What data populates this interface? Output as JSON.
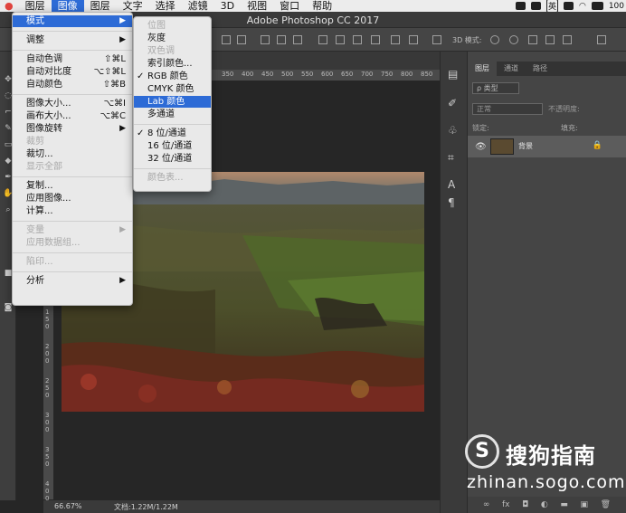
{
  "menubar": {
    "items": [
      "图像",
      "文字",
      "选择",
      "滤镜",
      "3D",
      "视图",
      "窗口",
      "帮助"
    ],
    "active_item": "图像",
    "prev_item": "图层",
    "right": {
      "input_method": "英",
      "extra": "100"
    }
  },
  "window": {
    "title": "Adobe Photoshop CC 2017"
  },
  "optionbar": {
    "mode_3d": "3D 模式:"
  },
  "image_menu": {
    "items": [
      {
        "label": "模式",
        "arrow": true,
        "highlighted": true
      },
      {
        "separator": true
      },
      {
        "label": "调整",
        "arrow": true
      },
      {
        "separator": true
      },
      {
        "label": "自动色调",
        "shortcut": "⇧⌘L"
      },
      {
        "label": "自动对比度",
        "shortcut": "⌥⇧⌘L"
      },
      {
        "label": "自动颜色",
        "shortcut": "⇧⌘B"
      },
      {
        "separator": true
      },
      {
        "label": "图像大小...",
        "shortcut": "⌥⌘I"
      },
      {
        "label": "画布大小...",
        "shortcut": "⌥⌘C"
      },
      {
        "label": "图像旋转",
        "arrow": true
      },
      {
        "label": "裁剪",
        "disabled": true
      },
      {
        "label": "裁切..."
      },
      {
        "label": "显示全部",
        "disabled": true
      },
      {
        "separator": true
      },
      {
        "label": "复制..."
      },
      {
        "label": "应用图像..."
      },
      {
        "label": "计算..."
      },
      {
        "separator": true
      },
      {
        "label": "变量",
        "arrow": true,
        "disabled": true
      },
      {
        "label": "应用数据组...",
        "disabled": true
      },
      {
        "separator": true
      },
      {
        "label": "陷印...",
        "disabled": true
      },
      {
        "separator": true
      },
      {
        "label": "分析",
        "arrow": true
      }
    ]
  },
  "mode_submenu": {
    "items": [
      {
        "label": "位图",
        "disabled": true
      },
      {
        "label": "灰度"
      },
      {
        "label": "双色调",
        "disabled": true
      },
      {
        "label": "索引颜色..."
      },
      {
        "label": "RGB 颜色",
        "checked": true
      },
      {
        "label": "CMYK 颜色"
      },
      {
        "label": "Lab 颜色",
        "highlighted": true
      },
      {
        "label": "多通道"
      },
      {
        "separator": true
      },
      {
        "label": "8 位/通道",
        "checked": true
      },
      {
        "label": "16 位/通道"
      },
      {
        "label": "32 位/通道"
      },
      {
        "separator": true
      },
      {
        "label": "颜色表...",
        "disabled": true
      }
    ]
  },
  "ruler": {
    "top_ticks": [
      "350",
      "400",
      "450",
      "500",
      "550",
      "600",
      "650",
      "700",
      "750",
      "800",
      "850"
    ],
    "left_ticks": [
      "1",
      "5",
      "0",
      "2",
      "0",
      "0",
      "2",
      "5",
      "0",
      "3",
      "0",
      "0",
      "3",
      "5",
      "0",
      "4",
      "0",
      "0"
    ]
  },
  "status": {
    "zoom": "66.67%",
    "doc": "文档:1.22M/1.22M"
  },
  "layers_panel": {
    "tabs": [
      "图层",
      "通道",
      "路径"
    ],
    "filter_label": "ρ 类型",
    "blend_mode": "正常",
    "opacity_label": "不透明度:",
    "lock_label": "锁定:",
    "fill_label": "填充:",
    "layer": {
      "name": "背景"
    },
    "bottom_icons": [
      "link-icon",
      "fx-icon",
      "mask-icon",
      "adjustment-icon",
      "folder-icon",
      "new-layer-icon",
      "trash-icon"
    ],
    "bottom_glyphs": [
      "∞",
      "fx",
      "◘",
      "◐",
      "▬",
      "▣",
      "🗑"
    ]
  },
  "watermark": {
    "logo": "S",
    "cn": "搜狗指南",
    "url": "zhinan.sogo.com"
  },
  "colors": {
    "menu_highlight": "#2d6bd6",
    "panel": "#454545",
    "workspace": "#262626"
  }
}
